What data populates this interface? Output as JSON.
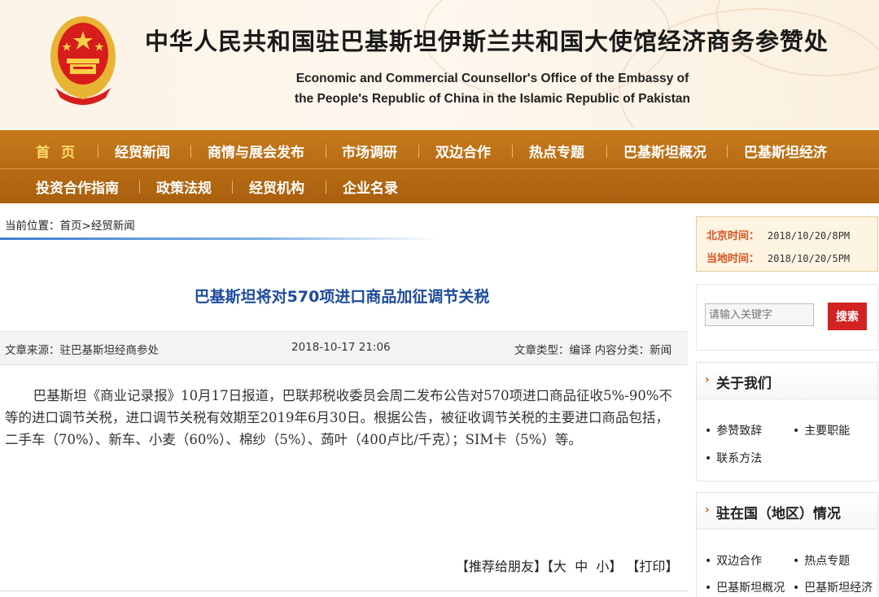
{
  "header": {
    "title_cn": "中华人民共和国驻巴基斯坦伊斯兰共和国大使馆经济商务参赞处",
    "title_en_line1": "Economic and Commercial Counsellor's Office of the Embassy of",
    "title_en_line2": "the People's Republic of China in the Islamic Republic of Pakistan"
  },
  "nav": {
    "row1": [
      "首页",
      "经贸新闻",
      "商情与展会发布",
      "市场调研",
      "双边合作",
      "热点专题",
      "巴基斯坦概况",
      "巴基斯坦经济"
    ],
    "row2": [
      "投资合作指南",
      "政策法规",
      "经贸机构",
      "企业名录"
    ]
  },
  "breadcrumb": {
    "prefix": "当前位置：",
    "home": "首页",
    "sep": ">",
    "current": "经贸新闻"
  },
  "article": {
    "title": "巴基斯坦将对570项进口商品加征调节关税",
    "source": "文章来源：驻巴基斯坦经商参处",
    "date": "2018-10-17 21:06",
    "type": "文章类型：编译 内容分类：新闻",
    "body": "巴基斯坦《商业记录报》10月17日报道，巴联邦税收委员会周二发布公告对570项进口商品征收5%-90%不等的进口调节关税，进口调节关税有效期至2019年6月30日。根据公告，被征收调节关税的主要进口商品包括，二手车（70%）、新车、小麦（60%）、棉纱（5%）、蒟叶（400卢比/千克）；SIM卡（5%）等。",
    "tools": {
      "recommend": "【推荐给朋友】",
      "font_open": "【",
      "large": "大",
      "medium": "中",
      "small": "小",
      "font_close": "】",
      "print": "【打印】"
    }
  },
  "sidebar": {
    "time": {
      "beijing_label": "北京时间：",
      "beijing_value": "2018/10/20/8PM",
      "local_label": "当地时间：",
      "local_value": "2018/10/20/5PM"
    },
    "search": {
      "placeholder": "请输入关键字",
      "button": "搜索"
    },
    "about": {
      "title": "关于我们",
      "links": [
        "参赞致辞",
        "主要职能",
        "联系方法"
      ]
    },
    "country": {
      "title": "驻在国（地区）情况",
      "links": [
        "双边合作",
        "热点专题",
        "巴基斯坦概况",
        "巴基斯坦经济"
      ]
    }
  },
  "colors": {
    "nav_bg": "#b96a13",
    "nav_home": "#ffdc6a",
    "title_blue": "#1e4b9c",
    "search_red": "#d22222",
    "accent_orange": "#d9531e"
  }
}
